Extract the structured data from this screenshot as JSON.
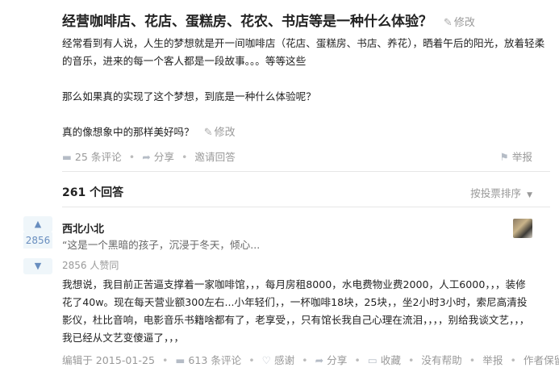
{
  "question": {
    "title": "经营咖啡店、花店、蛋糕房、花农、书店等是一种什么体验？",
    "edit_label": "修改",
    "paragraphs": [
      "经常看到有人说，人生的梦想就是开一间咖啡店（花店、蛋糕房、书店、养花），晒着午后的阳光，放着轻柔的音乐，进来的每一个客人都是一段故事。。。等等这些",
      "那么如果真的实现了这个梦想，到底是一种什么体验呢？",
      "真的像想象中的那样美好吗？"
    ],
    "actions": {
      "comments": "25 条评论",
      "share": "分享",
      "invite": "邀请回答",
      "report": "举报"
    }
  },
  "answers_header": {
    "count": "261 个回答",
    "sort": "按投票排序"
  },
  "answer": {
    "votes": "2856",
    "author": "西北小北",
    "bio": "“这是一个黑暗的孩子，沉浸于冬天，倾心...",
    "upvote_text": "2856 人赞同",
    "content": "我想说，我目前正苦逼支撑着一家咖啡馆，，，每月房租8000，水电费物业费2000，人工6000，，，装修花了40w。现在每天营业额300左右...小年轻们，，一杯咖啡18块，25块，，坐2小时3小时，索尼高清投影仪，杜比音响，电影音乐书籍啥都有了，老享受，，只有馆长我自己心理在流泪，，，，别给我谈文艺，，，我已经从文艺变傻逼了，，，",
    "footer": {
      "edited": "编辑于 2015-01-25",
      "comments": "613 条评论",
      "thanks": "感谢",
      "share": "分享",
      "collect": "收藏",
      "no_help": "没有帮助",
      "report": "举报",
      "copyright": "作者保留权利"
    }
  },
  "colors": {
    "vote_bg": "#eff6fa",
    "vote_fg": "#698ebf",
    "meta": "#999999"
  },
  "icons": [
    "pencil-icon",
    "comment-icon",
    "share-icon",
    "report-icon",
    "up-arrow-icon",
    "down-arrow-icon",
    "thanks-icon",
    "collect-icon"
  ]
}
